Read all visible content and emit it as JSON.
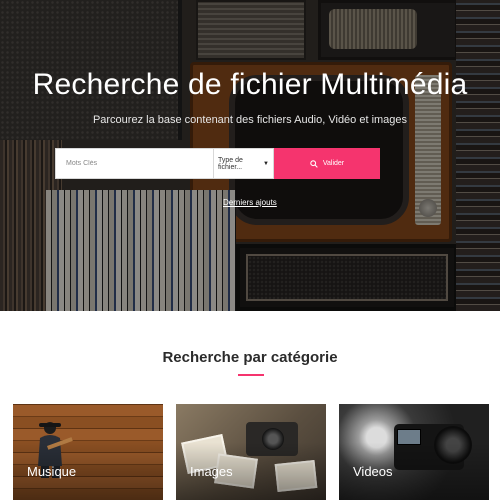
{
  "hero": {
    "title": "Recherche de fichier Multimédia",
    "subtitle": "Parcourez la base contenant des fichiers Audio, Vidéo et images"
  },
  "search": {
    "placeholder": "Mots Clés",
    "type_select": "Type de fichier...",
    "submit_label": "Valider",
    "recent_link": "Derniers ajouts"
  },
  "categories": {
    "title": "Recherche par catégorie",
    "items": [
      {
        "label": "Musique"
      },
      {
        "label": "Images"
      },
      {
        "label": "Videos"
      }
    ]
  },
  "colors": {
    "accent": "#f5346e"
  }
}
